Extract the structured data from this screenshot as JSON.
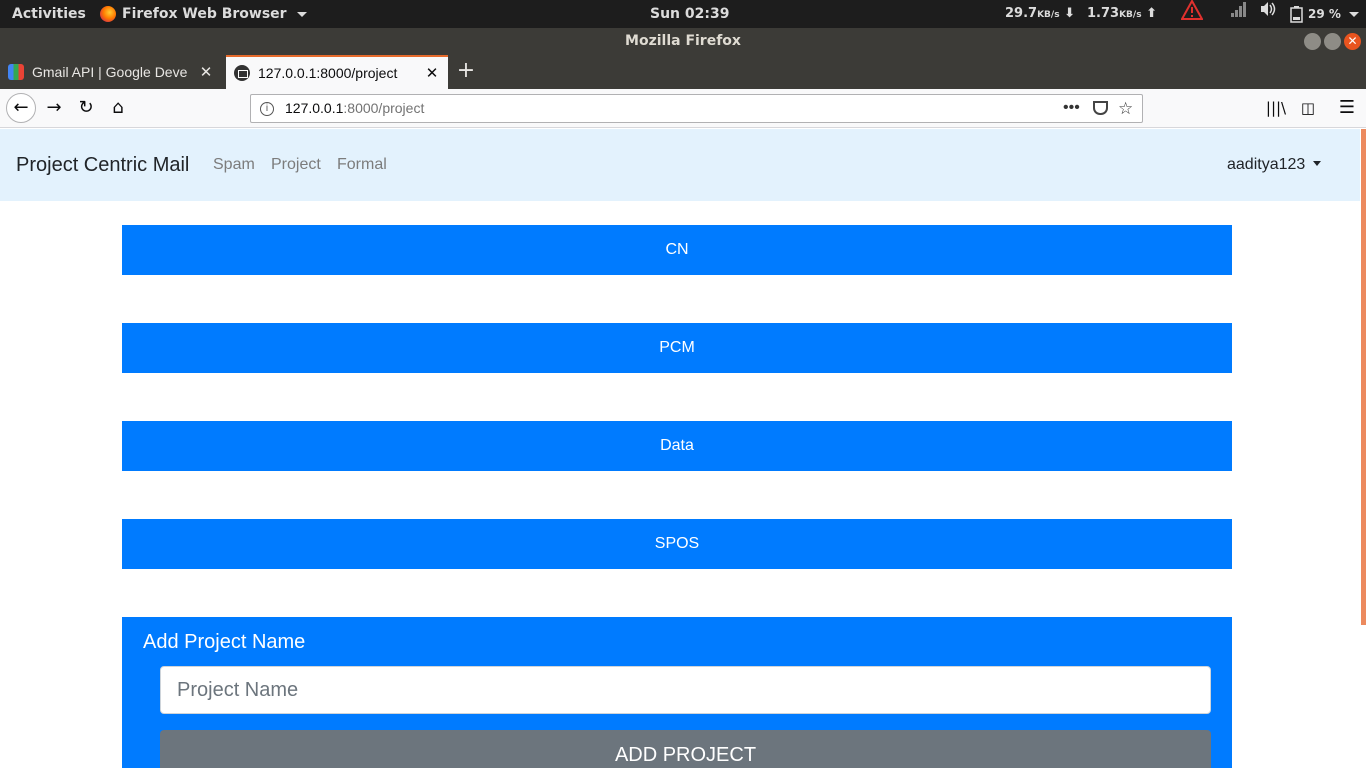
{
  "system_bar": {
    "activities": "Activities",
    "app_name": "Firefox Web Browser",
    "clock": "Sun 02:39",
    "net_down_value": "29.7",
    "net_down_unit": "KB/s",
    "net_up_value": "1.73",
    "net_up_unit": "KB/s",
    "battery": "29 %"
  },
  "window": {
    "title": "Mozilla Firefox"
  },
  "tabs": [
    {
      "title": "Gmail API | Google Deve",
      "favicon": "google-developers-icon",
      "active": false
    },
    {
      "title": "127.0.0.1:8000/project",
      "favicon": "mail-icon",
      "active": true
    }
  ],
  "urlbar": {
    "host": "127.0.0.1",
    "path": ":8000/project"
  },
  "site": {
    "brand": "Project Centric Mail",
    "nav": [
      "Spam",
      "Project",
      "Formal"
    ],
    "user": "aaditya123"
  },
  "projects": [
    "CN",
    "PCM",
    "Data",
    "SPOS"
  ],
  "add_form": {
    "title": "Add Project Name",
    "placeholder": "Project Name",
    "button": "ADD PROJECT"
  },
  "colors": {
    "primary": "#007bff",
    "secondary": "#6c757d",
    "navbar_bg": "#e3f2fd",
    "tab_accent": "#e66a2b"
  }
}
